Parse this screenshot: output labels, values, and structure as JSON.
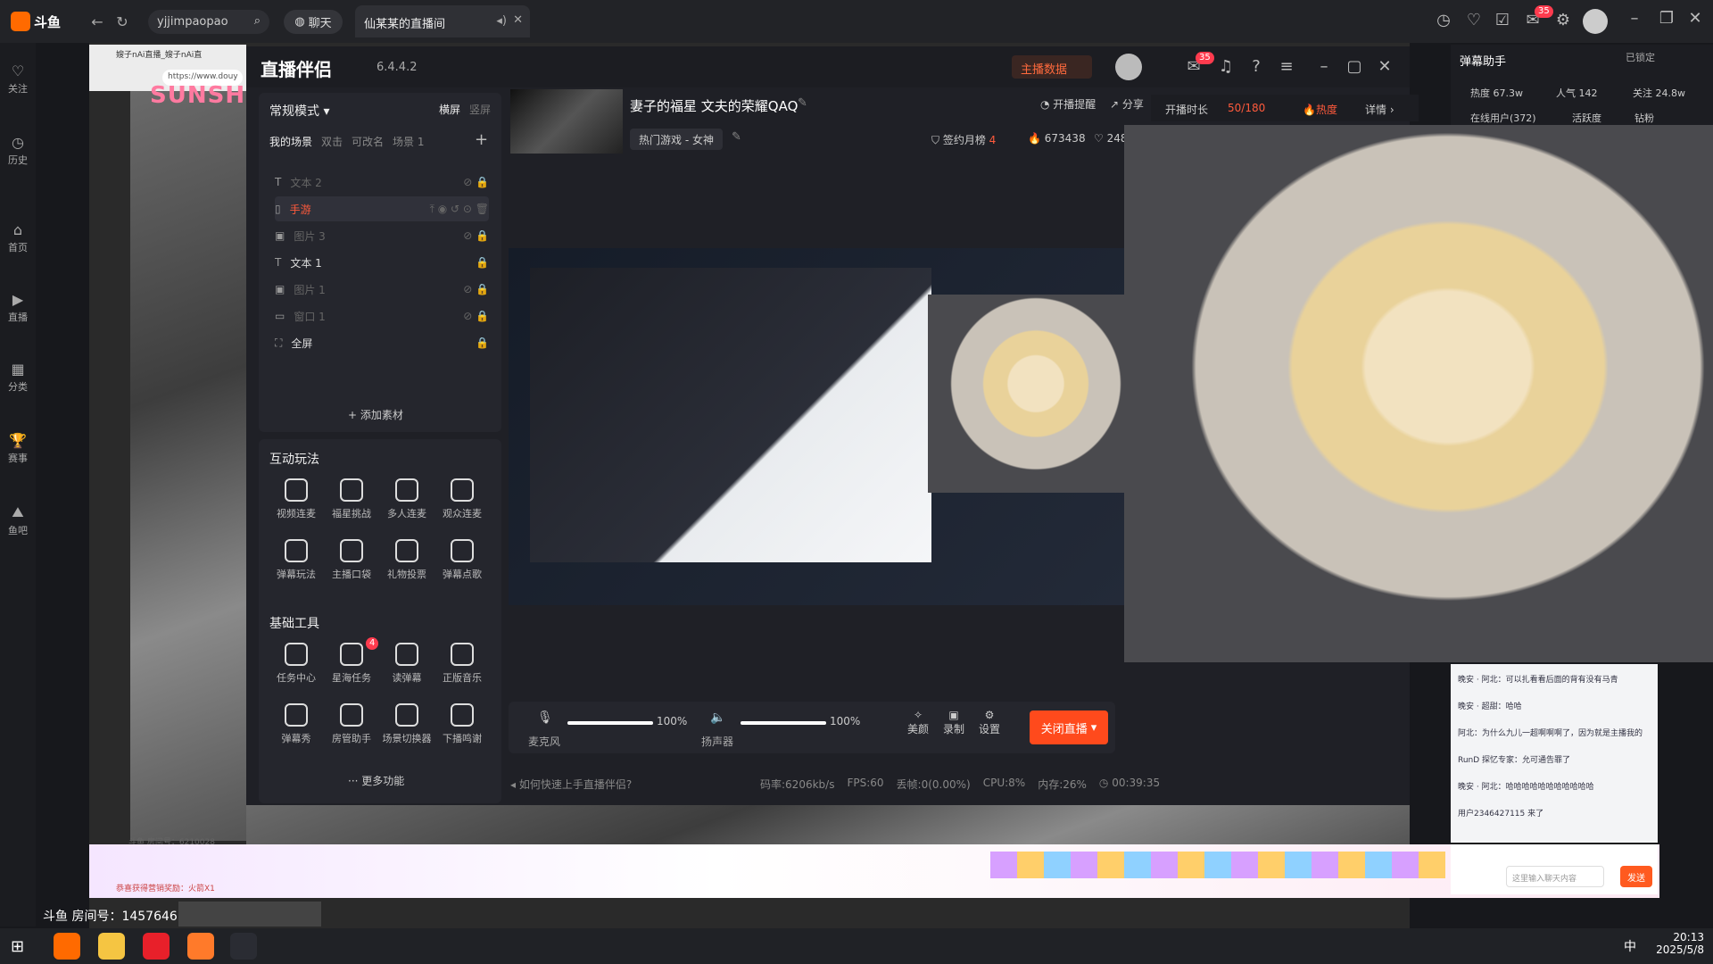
{
  "topbar": {
    "logo": "斗鱼",
    "search_value": "yjjimpaopao",
    "chat_label": "聊天",
    "tab_title": "仙某某的直播间",
    "notif_count": "35"
  },
  "sidebar": {
    "items": [
      {
        "label": "关注",
        "icon": "heart-icon"
      },
      {
        "label": "历史",
        "icon": "clock-icon"
      },
      {
        "label": "首页",
        "icon": "home-icon"
      },
      {
        "label": "直播",
        "icon": "live-icon"
      },
      {
        "label": "分类",
        "icon": "grid-icon"
      },
      {
        "label": "赛事",
        "icon": "trophy-icon"
      },
      {
        "label": "鱼吧",
        "icon": "fish-icon"
      }
    ]
  },
  "embed": {
    "url": "https://www.douy",
    "tab_text": "嫂子nAi直播_嫂子nAi直",
    "overlay_text": "SUNSHINE",
    "room_label": "斗鱼 房间号：",
    "room_number": "1457646",
    "small_room": "斗鱼 房间号：6210028",
    "reward_text": "恭喜获得营销奖励：火箭X1"
  },
  "app": {
    "title": "直播伴侣",
    "version": "6.4.4.2",
    "host_data": "主播数据",
    "msg_count": "35",
    "mode": "常规模式",
    "orient_h": "横屏",
    "orient_v": "竖屏",
    "scene_tabs": [
      "我的场景",
      "双击",
      "可改名",
      "场景 1"
    ],
    "scenes": [
      {
        "label": "文本 2",
        "icon": "text-icon",
        "active": false,
        "dim": true
      },
      {
        "label": "手游",
        "icon": "phone-icon",
        "active": true,
        "dim": false
      },
      {
        "label": "图片 3",
        "icon": "image-icon",
        "active": false,
        "dim": true
      },
      {
        "label": "文本 1",
        "icon": "text-icon",
        "active": false,
        "dim": false
      },
      {
        "label": "图片 1",
        "icon": "image-icon",
        "active": false,
        "dim": true
      },
      {
        "label": "窗口 1",
        "icon": "window-icon",
        "active": false,
        "dim": true
      },
      {
        "label": "全屏",
        "icon": "fullscreen-icon",
        "active": false,
        "dim": false
      }
    ],
    "add_material": "添加素材",
    "interactive_title": "互动玩法",
    "interactive": [
      "视频连麦",
      "福星挑战",
      "多人连麦",
      "观众连麦",
      "弹幕玩法",
      "主播口袋",
      "礼物投票",
      "弹幕点歌"
    ],
    "basic_title": "基础工具",
    "basic": [
      "任务中心",
      "星海任务",
      "读弹幕",
      "正版音乐",
      "弹幕秀",
      "房管助手",
      "场景切换器",
      "下播鸣谢"
    ],
    "basic_badge": "4",
    "more": "更多功能",
    "stream_title": "妻子的福星 文夫的荣耀QAQ",
    "category": "热门游戏 - 女神",
    "reminder": "开播提醒",
    "share": "分享",
    "sign_month": "签约月榜",
    "sign_value": "4",
    "hot_value": "673438",
    "like_value": "248",
    "mic_label": "麦克风",
    "mic_pct": "100%",
    "mic_level": 1.0,
    "speaker_label": "扬声器",
    "speaker_pct": "100%",
    "speaker_level": 1.0,
    "beauty": "美颜",
    "record": "录制",
    "settings": "设置",
    "stop_live": "关闭直播",
    "help": "如何快速上手直播伴侣?",
    "bitrate": "码率:6206kb/s",
    "fps": "FPS:60",
    "dropped": "丢帧:0(0.00%)",
    "cpu": "CPU:8%",
    "memory": "内存:26%",
    "duration": "00:39:35"
  },
  "danmu": {
    "title": "弹幕助手",
    "locked": "已锁定",
    "live_time": "开播时长",
    "live_time_val": "50/180",
    "hot": "热度",
    "detail": "详情",
    "heat": "热度 67.3w",
    "popularity": "人气 142",
    "follow": "关注 24.8w",
    "online": "在线用户(372)",
    "activity": "活跃度",
    "fans": "钻粉",
    "chat": [
      "晚安 · 阿北：可以扎看看后面的背有没有马青",
      "晚安 · 超甜：哈哈",
      "阿北：为什么九儿一超啊啊啊了，因为就是主播我的",
      "RunD 探忆专家：允可通告罪了",
      "晚安 · 阿北：哈哈哈哈哈哈哈哈哈哈哈",
      "用户2346427115 来了"
    ],
    "input_placeholder": "这里输入聊天内容",
    "send": "发送"
  },
  "taskbar": {
    "time": "20:13",
    "date": "2025/5/8",
    "ime": "中"
  },
  "inner_taskbar": {
    "time": "20:13",
    "date": "2025/5/8"
  },
  "colors": {
    "accent": "#ff5a1f",
    "active_scene": "#ff5a3c",
    "panel": "#25262d"
  }
}
